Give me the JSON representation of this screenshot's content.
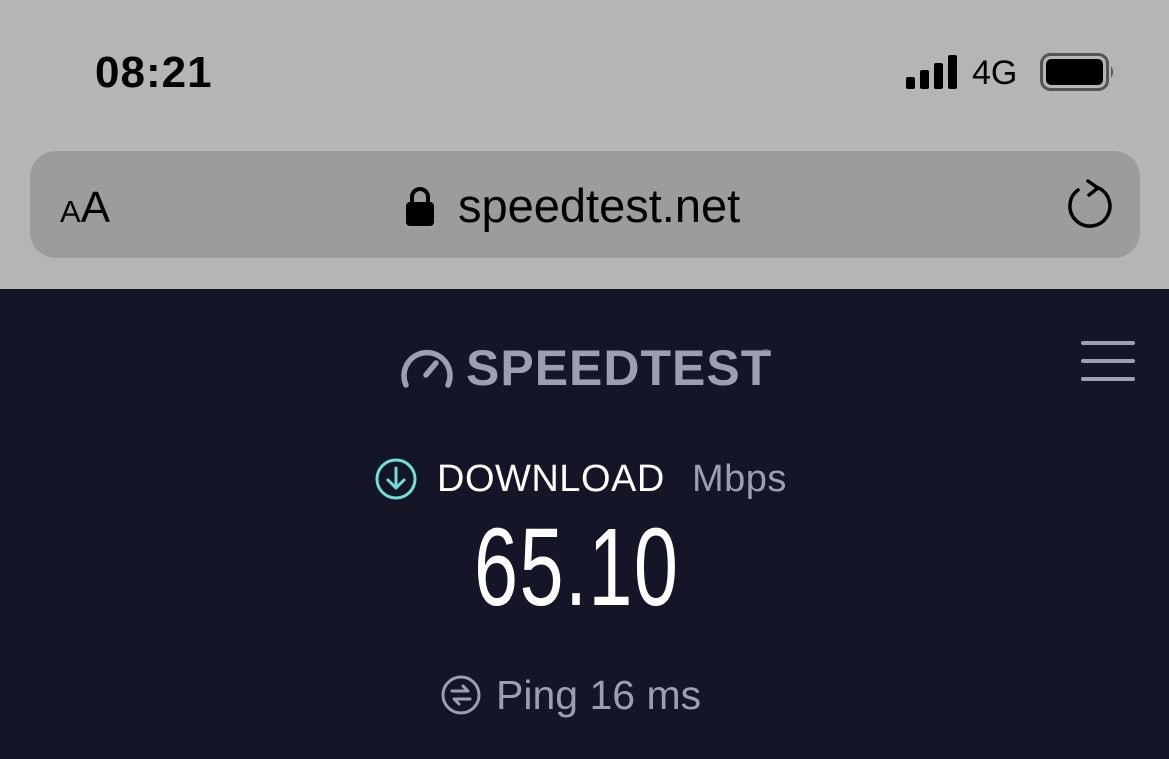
{
  "status_bar": {
    "time": "08:21",
    "network": "4G",
    "signal_bars": 4,
    "battery_level": 1.0
  },
  "browser": {
    "text_size_button": {
      "small": "A",
      "large": "A"
    },
    "url": "speedtest.net",
    "lock_icon": "lock-icon",
    "reload_icon": "reload-icon"
  },
  "page": {
    "logo": {
      "icon": "speedometer-icon",
      "text": "SPEEDTEST",
      "registered_mark": "®"
    },
    "menu_icon": "hamburger-menu-icon",
    "download": {
      "icon": "download-arrow-icon",
      "label": "DOWNLOAD",
      "unit": "Mbps",
      "value": "65.10"
    },
    "ping": {
      "icon": "ping-icon",
      "text": "Ping 16 ms"
    }
  },
  "colors": {
    "chrome_bg": "#b5b5b5",
    "url_bar_bg": "#9c9c9c",
    "page_bg": "#141526",
    "muted_text": "#9d9fb0",
    "accent_cyan": "#6fe0d8"
  }
}
